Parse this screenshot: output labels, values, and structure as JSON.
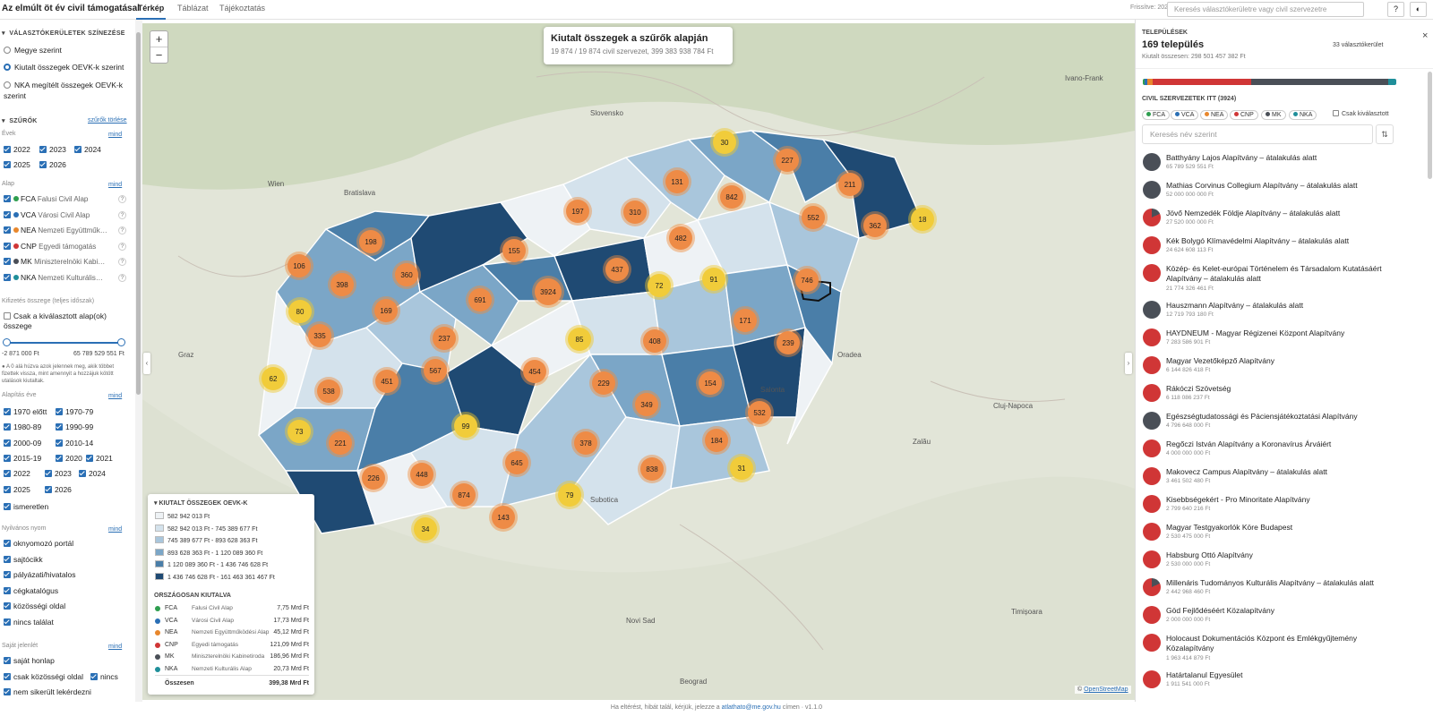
{
  "app": {
    "title": "Az elmúlt öt év civil támogatásai"
  },
  "tabs": [
    "Térkép",
    "Táblázat",
    "Tájékoztatás"
  ],
  "topbar": {
    "freshness": "Frissítve: 2026.08.17",
    "search_placeholder": "Keresés választókerületre vagy civil szervezetre",
    "help": "?",
    "theme": "◐"
  },
  "left": {
    "coloring": {
      "title": "VÁLASZTÓKERÜLETEK SZÍNEZÉSE",
      "options": [
        "Megye szerint",
        "Kiutalt összegek OEVK-k szerint",
        "NKA megítélt összegek OEVK-k szerint"
      ]
    },
    "filters": {
      "title": "SZŰRŐK",
      "clear": "szűrők törlése",
      "years_label": "Évek",
      "all": "mind",
      "years": [
        "2022",
        "2023",
        "2024",
        "2025",
        "2026"
      ],
      "fund_label": "Alap",
      "funds": [
        {
          "code": "FCA",
          "name": "Falusi Civil Alap",
          "color": "#2e9e4f"
        },
        {
          "code": "VCA",
          "name": "Városi Civil Alap",
          "color": "#2a6fb5"
        },
        {
          "code": "NEA",
          "name": "Nemzeti Együttműk…",
          "color": "#e8872c"
        },
        {
          "code": "CNP",
          "name": "Egyedi támogatás",
          "color": "#d03636"
        },
        {
          "code": "MK",
          "name": "Miniszterelnöki Kabi…",
          "color": "#4a4f57"
        },
        {
          "code": "NKA",
          "name": "Nemzeti Kulturális…",
          "color": "#1f8f9a"
        }
      ],
      "payout_label": "Kifizetés összege (teljes időszak)",
      "only_selected": "Csak a kiválasztott alap(ok) összege",
      "range_min": "-2 871 000 Ft",
      "range_max": "65 789 529 551 Ft",
      "note": "A 0 alá húzva azok jelennek meg, akik többet fizettek vissza, mint amennyit a hozzájuk kötött utalások kiutaltak.",
      "founding_label": "Alapítás éve",
      "founding": [
        "1970 előtt",
        "1970-79",
        "1980-89",
        "1990-99",
        "2000-09",
        "2010-14",
        "2015-19",
        "2020",
        "2021",
        "2022",
        "2023",
        "2024",
        "2025",
        "2026",
        "ismeretlen"
      ],
      "public_label": "Nyilvános nyom",
      "public": [
        "oknyomozó portál",
        "sajtócikk",
        "pályázati/hivatalos",
        "cégkatalógus",
        "közösségi oldal",
        "nincs találat"
      ],
      "own_label": "Saját jelenlét",
      "own": [
        "saját honlap",
        "csak közösségi oldal",
        "nincs",
        "nem sikerült lekérdezni"
      ]
    }
  },
  "map": {
    "title": "Kiutalt összegek a szűrők alapján",
    "subtitle": "19 874 / 19 874 civil szervezet, 399 383 938 784 Ft",
    "zoom_in": "+",
    "zoom_out": "−",
    "clusters": [
      "30",
      "227",
      "131",
      "842",
      "211",
      "197",
      "310",
      "552",
      "362",
      "18",
      "198",
      "155",
      "482",
      "106",
      "398",
      "360",
      "437",
      "3924",
      "72",
      "91",
      "746",
      "691",
      "80",
      "169",
      "171",
      "85",
      "335",
      "237",
      "408",
      "239",
      "62",
      "567",
      "451",
      "454",
      "538",
      "229",
      "154",
      "349",
      "532",
      "73",
      "99",
      "378",
      "184",
      "221",
      "645",
      "31",
      "448",
      "226",
      "838",
      "874",
      "79",
      "143",
      "34"
    ],
    "attribution_prefix": "© ",
    "attribution_link": "OpenStreetMap",
    "place_names": [
      "Bratislava",
      "Wien",
      "Graz",
      "Slovensko",
      "Oradea",
      "Cluj-Napoca",
      "Timișoara",
      "Novi Sad",
      "Subotica",
      "Beograd",
      "Salonta",
      "Zalău",
      "Ivano-Frank"
    ]
  },
  "legend": {
    "title": "KIUTALT ÖSSZEGEK OEVK-K",
    "bins": [
      {
        "label": "582 942 013 Ft",
        "color": "#eef2f5"
      },
      {
        "label": "582 942 013 Ft - 745 389 677 Ft",
        "color": "#d4e2ec"
      },
      {
        "label": "745 389 677 Ft - 893 628 363 Ft",
        "color": "#a9c6dc"
      },
      {
        "label": "893 628 363 Ft - 1 120 089 360 Ft",
        "color": "#7ba6c7"
      },
      {
        "label": "1 120 089 360 Ft - 1 436 746 628 Ft",
        "color": "#4a7ea8"
      },
      {
        "label": "1 436 746 628 Ft - 161 463 361 467 Ft",
        "color": "#1f4a73"
      }
    ],
    "national_title": "ORSZÁGOSAN KIUTALVA",
    "national": [
      {
        "code": "FCA",
        "name": "Falusi Civil Alap",
        "value": "7,75 Mrd Ft",
        "color": "#2e9e4f"
      },
      {
        "code": "VCA",
        "name": "Városi Civil Alap",
        "value": "17,73 Mrd Ft",
        "color": "#2a6fb5"
      },
      {
        "code": "NEA",
        "name": "Nemzeti Együttműködési Alap",
        "value": "45,12 Mrd Ft",
        "color": "#e8872c"
      },
      {
        "code": "CNP",
        "name": "Egyedi támogatás",
        "value": "121,09 Mrd Ft",
        "color": "#d03636"
      },
      {
        "code": "MK",
        "name": "Miniszterelnöki Kabinetiroda",
        "value": "186,96 Mrd Ft",
        "color": "#4a4f57"
      },
      {
        "code": "NKA",
        "name": "Nemzeti Kulturális Alap",
        "value": "20,73 Mrd Ft",
        "color": "#1f8f9a"
      }
    ],
    "total_label": "Összesen",
    "total_value": "399,38 Mrd Ft"
  },
  "right": {
    "section": "TELEPÜLÉSEK",
    "count": "169 település",
    "districts": "33 választókerület",
    "total": "Kiutalt összesen: 298 501 457 382 Ft",
    "close": "×",
    "bar": [
      {
        "fund": "FCA",
        "share": 0.006,
        "color": "#2e9e4f"
      },
      {
        "fund": "VCA",
        "share": 0.012,
        "color": "#2a6fb5"
      },
      {
        "fund": "NEA",
        "share": 0.02,
        "color": "#e8872c"
      },
      {
        "fund": "CNP",
        "share": 0.39,
        "color": "#d03636"
      },
      {
        "fund": "MK",
        "share": 0.54,
        "color": "#4a4f57"
      },
      {
        "fund": "NKA",
        "share": 0.032,
        "color": "#1f8f9a"
      }
    ],
    "orgs_title": "CIVIL SZERVEZETEK ITT (3924)",
    "chips": [
      "FCA",
      "VCA",
      "NEA",
      "CNP",
      "MK",
      "NKA"
    ],
    "only_selected": "Csak kiválasztott",
    "search_placeholder": "Keresés név szerint",
    "sort": "⇅",
    "orgs": [
      {
        "name": "Batthyány Lajos Alapítvány – átalakulás alatt",
        "amount": "65 789 529 551 Ft",
        "color": "#4a4f57"
      },
      {
        "name": "Mathias Corvinus Collegium Alapítvány – átalakulás alatt",
        "amount": "52 000 000 000 Ft",
        "color": "#4a4f57"
      },
      {
        "name": "Jövő Nemzedék Földje Alapítvány – átalakulás alatt",
        "amount": "27 520 000 000 Ft",
        "color": "#d03636",
        "split": "#4a4f57"
      },
      {
        "name": "Kék Bolygó Klímavédelmi Alapítvány – átalakulás alatt",
        "amount": "24 624 608 113 Ft",
        "color": "#d03636"
      },
      {
        "name": "Közép- és Kelet-európai Történelem és Társadalom Kutatásáért Alapítvány – átalakulás alatt",
        "amount": "21 774 326 461 Ft",
        "color": "#d03636"
      },
      {
        "name": "Hauszmann Alapítvány – átalakulás alatt",
        "amount": "12 719 793 180 Ft",
        "color": "#4a4f57"
      },
      {
        "name": "HAYDNEUM - Magyar Régizenei Központ Alapítvány",
        "amount": "7 283 586 901 Ft",
        "color": "#d03636"
      },
      {
        "name": "Magyar Vezetőképző Alapítvány",
        "amount": "6 144 826 418 Ft",
        "color": "#d03636"
      },
      {
        "name": "Rákóczi Szövetség",
        "amount": "6 118 086 237 Ft",
        "color": "#d03636"
      },
      {
        "name": "Egészségtudatossági és Páciensjátékoztatási Alapítvány",
        "amount": "4 796 648 000 Ft",
        "color": "#4a4f57"
      },
      {
        "name": "Regőczi István Alapítvány a Koronavírus Árváiért",
        "amount": "4 000 000 000 Ft",
        "color": "#d03636"
      },
      {
        "name": "Makovecz Campus Alapítvány – átalakulás alatt",
        "amount": "3 461 502 480 Ft",
        "color": "#d03636"
      },
      {
        "name": "Kisebbségekért - Pro Minoritate Alapítvány",
        "amount": "2 799 640 216 Ft",
        "color": "#d03636"
      },
      {
        "name": "Magyar Testgyakorlók Köre Budapest",
        "amount": "2 530 475 000 Ft",
        "color": "#d03636"
      },
      {
        "name": "Habsburg Ottó Alapítvány",
        "amount": "2 530 000 000 Ft",
        "color": "#d03636"
      },
      {
        "name": "Millenáris Tudományos Kulturális Alapítvány – átalakulás alatt",
        "amount": "2 442 968 460 Ft",
        "color": "#d03636",
        "split": "#4a4f57"
      },
      {
        "name": "Göd Fejlődéséért Közalapítvány",
        "amount": "2 000 000 000 Ft",
        "color": "#d03636"
      },
      {
        "name": "Holocaust Dokumentációs Központ és Emlékgyűjtemény Közalapítvány",
        "amount": "1 963 414 879 Ft",
        "color": "#d03636"
      },
      {
        "name": "Határtalanul Egyesület",
        "amount": "1 911 541 000 Ft",
        "color": "#d03636"
      }
    ]
  },
  "footer": {
    "prefix": "Ha eltérést, hibát talál, kérjük, jelezze a ",
    "email": "atlathato@me.gov.hu",
    "suffix": " címen · v1.1.0"
  }
}
